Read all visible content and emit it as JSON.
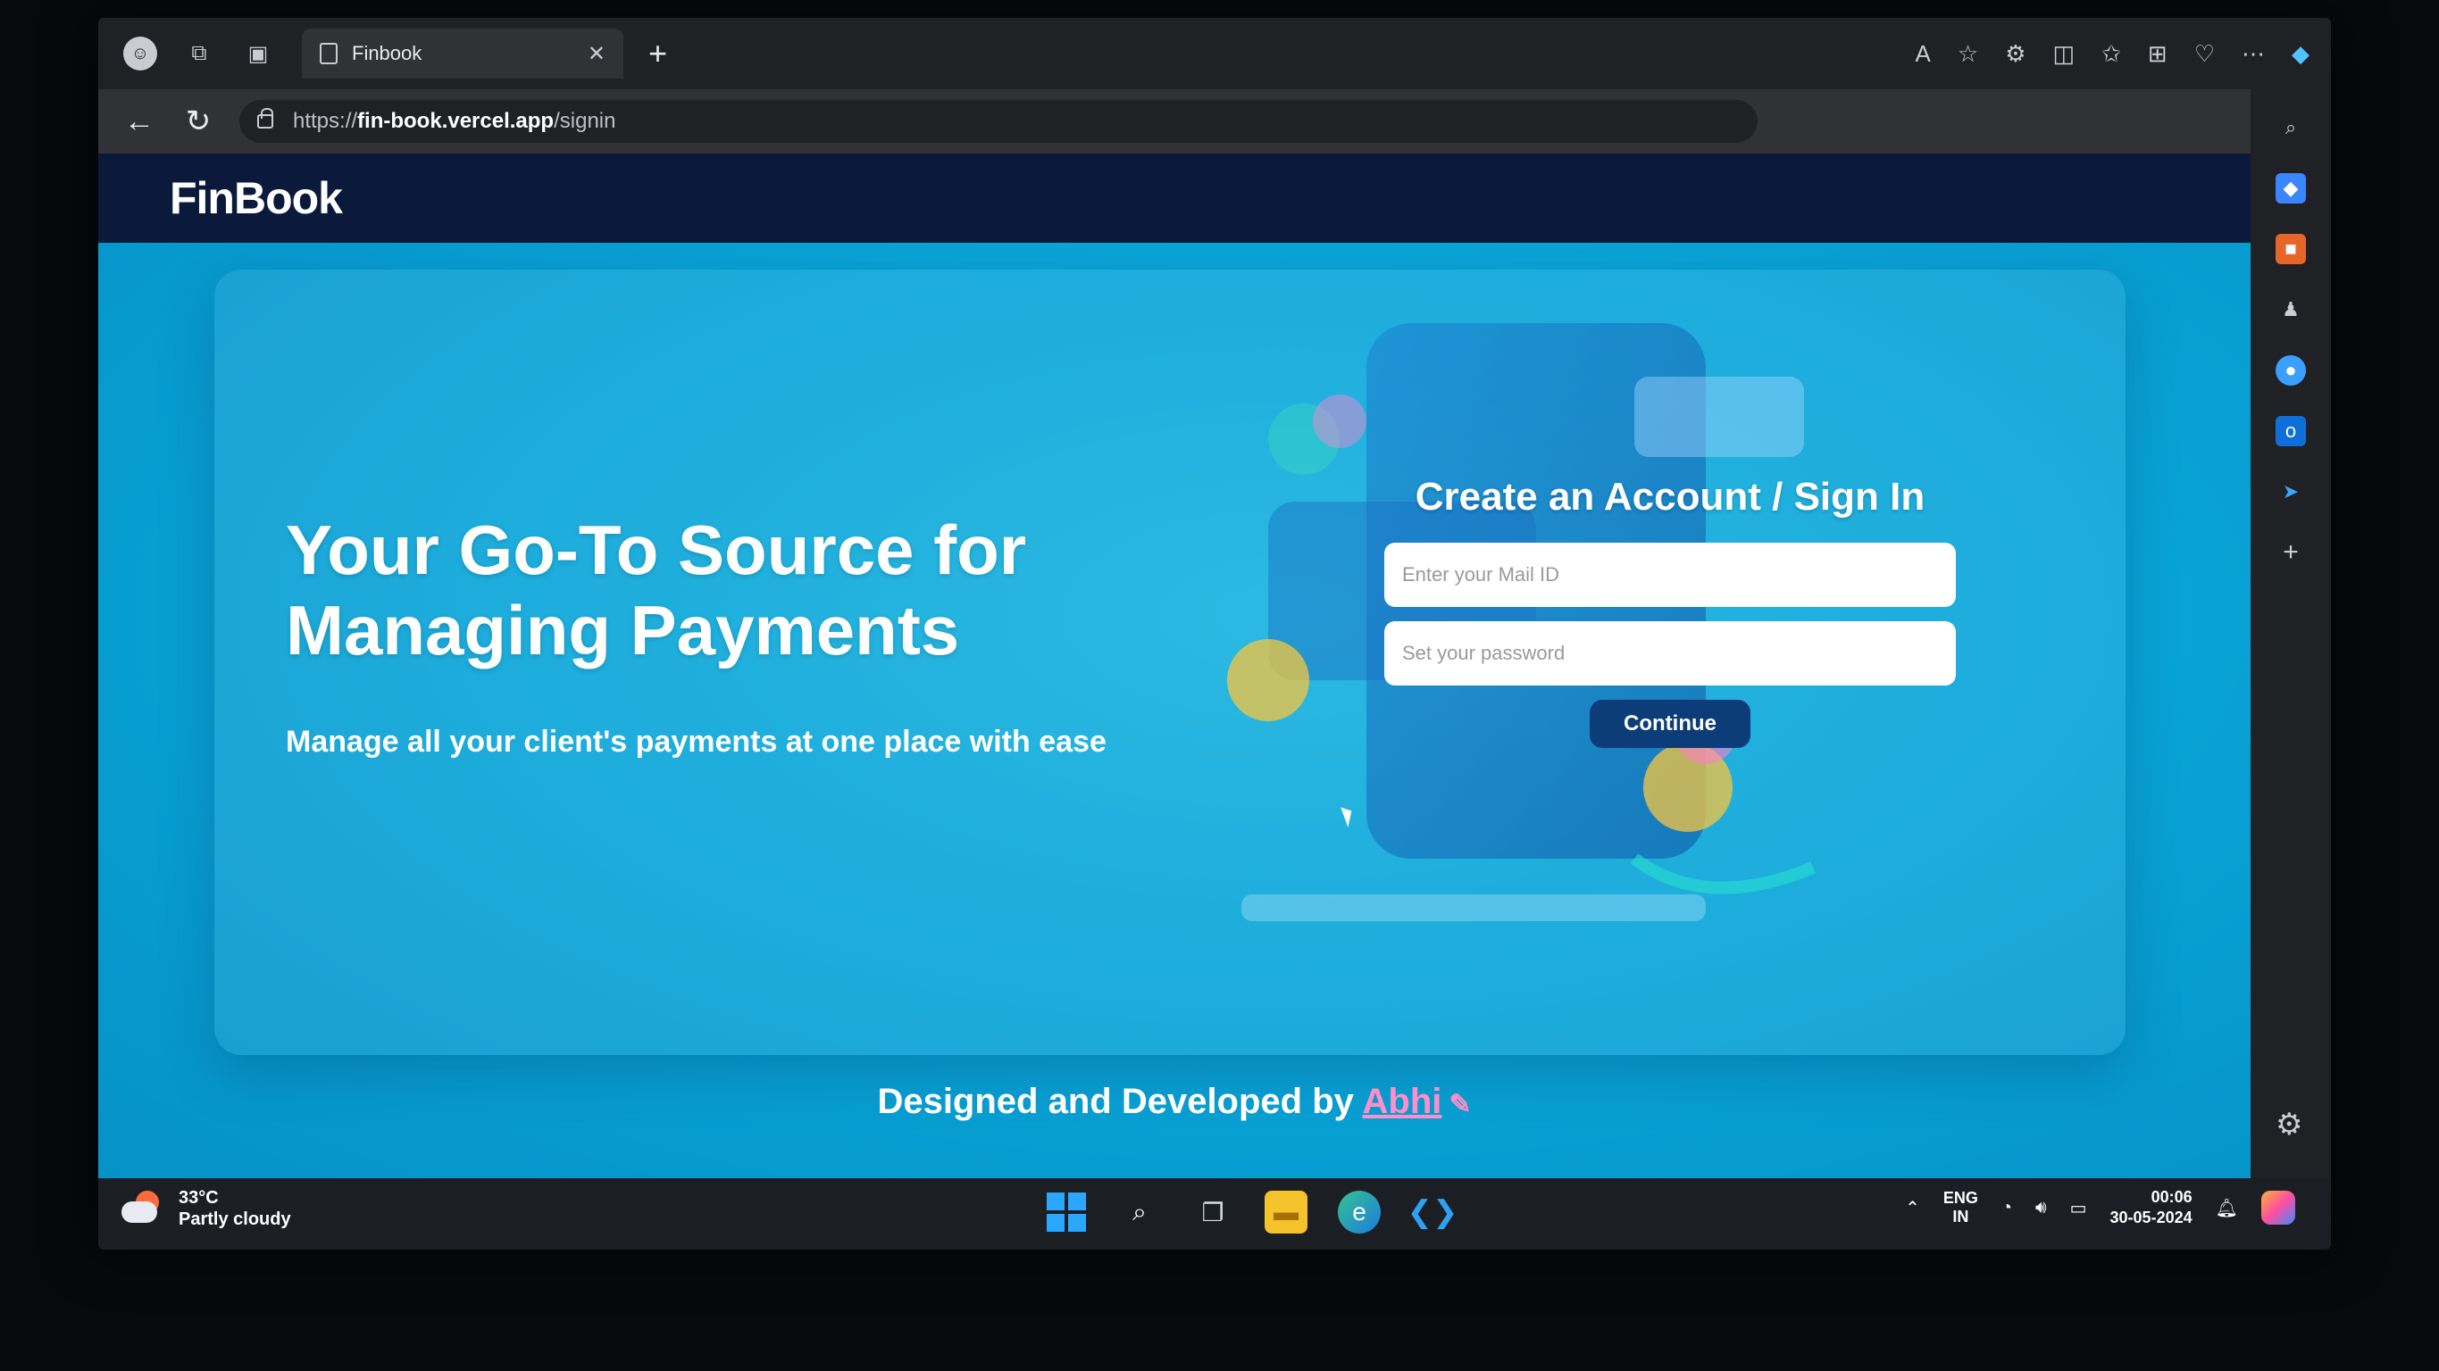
{
  "browser": {
    "tab_title": "Finbook",
    "new_tab_label": "+",
    "url_scheme": "https://",
    "url_domain": "fin-book.vercel.app",
    "url_path": "/signin"
  },
  "page": {
    "brand": "FinBook",
    "headline": "Your Go-To Source for Managing Payments",
    "subline": "Manage all your client's payments at one place with ease",
    "form": {
      "title": "Create an Account / Sign In",
      "email_placeholder": "Enter your Mail ID",
      "password_placeholder": "Set your password",
      "continue_label": "Continue"
    },
    "footer": {
      "prefix": "Designed and Developed by ",
      "author": "Abhi"
    }
  },
  "taskbar": {
    "temperature": "33°C",
    "weather": "Partly cloudy",
    "lang_top": "ENG",
    "lang_bottom": "IN",
    "time": "00:06",
    "date": "30-05-2024"
  },
  "colors": {
    "page_bg": "#0aa6d9",
    "topbar_bg": "#0b1a3b",
    "button_bg": "#0d3d78",
    "author_link": "#ff8fc8"
  }
}
